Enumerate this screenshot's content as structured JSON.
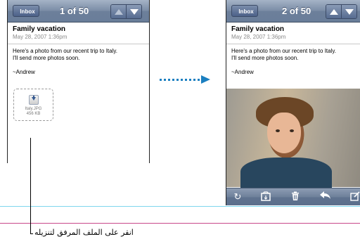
{
  "left_screen": {
    "back_label": "Inbox",
    "title": "1 of 50",
    "email": {
      "subject": "Family vacation",
      "date": "May 28, 2007 1:36pm",
      "body_line1": "Here's a photo from our recent trip to Italy.",
      "body_line2": "I'll send more photos soon.",
      "signature": "~Andrew"
    },
    "attachment": {
      "name": "Italy.JPG",
      "size": "456 KB",
      "icon": "download-icon"
    }
  },
  "right_screen": {
    "back_label": "Inbox",
    "title": "2 of 50",
    "email": {
      "subject": "Family vacation",
      "date": "May 28, 2007 1:36pm",
      "body_line1": "Here's a photo from our recent trip to Italy.",
      "body_line2": "I'll send more photos soon.",
      "signature": "~Andrew"
    },
    "toolbar_icons": [
      "refresh-icon",
      "move-to-folder-icon",
      "trash-icon",
      "reply-icon",
      "compose-icon"
    ]
  },
  "callout": {
    "text": "انقر على الملف المرفق لتنزيله"
  },
  "colors": {
    "arrow": "#1b7fc0",
    "cyan_rule": "#7fd6ee",
    "pink_rule": "#c8488a",
    "navbar": "#6c7f9b"
  }
}
